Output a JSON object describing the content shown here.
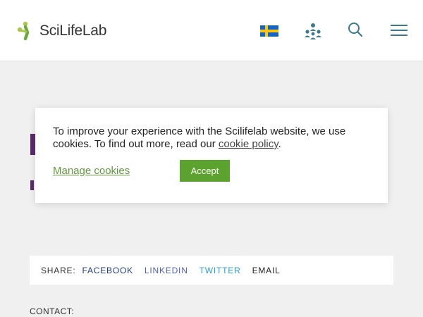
{
  "header": {
    "logo_text": "SciLifeLab",
    "logo_colors": [
      "#a7c947",
      "#6aaa3a"
    ],
    "icons": [
      "swedish-flag-icon",
      "people-network-icon",
      "search-icon",
      "menu-icon"
    ],
    "accent": "#3a7a8c"
  },
  "cookie_banner": {
    "text_before_link": "To improve your experience with the Scilifelab website, we use cookies. To find out more, read our ",
    "link_text": "cookie policy",
    "text_after_link": ".",
    "manage_label": "Manage cookies",
    "accept_label": "Accept",
    "accept_color": "#5ca22e"
  },
  "share": {
    "label": "SHARE:",
    "links": [
      {
        "label": "FACEBOOK",
        "color": "#1d3a8a"
      },
      {
        "label": "LINKEDIN",
        "color": "#4a5fc1"
      },
      {
        "label": "TWITTER",
        "color": "#2a9fd6"
      },
      {
        "label": "EMAIL",
        "color": "#222222"
      }
    ]
  },
  "contact": {
    "label": "CONTACT:"
  }
}
